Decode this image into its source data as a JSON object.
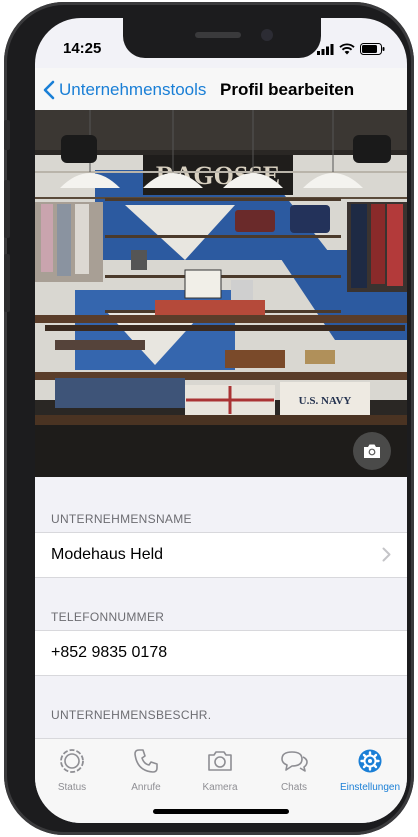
{
  "status_bar": {
    "time": "14:25"
  },
  "nav": {
    "back_label": "Unternehmenstools",
    "title": "Profil bearbeiten"
  },
  "hero": {
    "sign_text": "RAGOSSE",
    "crate_text": "U.S. NAVY",
    "camera_button_icon": "camera-icon"
  },
  "sections": [
    {
      "label": "UNTERNEHMENSNAME",
      "value": "Modehaus Held"
    },
    {
      "label": "TELEFONNUMMER",
      "value": "+852 9835 0178"
    },
    {
      "label": "UNTERNEHMENSBESCHR."
    }
  ],
  "tabs": [
    {
      "label": "Status",
      "icon": "status-icon"
    },
    {
      "label": "Anrufe",
      "icon": "phone-icon"
    },
    {
      "label": "Kamera",
      "icon": "camera-icon"
    },
    {
      "label": "Chats",
      "icon": "chat-bubbles-icon"
    },
    {
      "label": "Einstellungen",
      "icon": "gear-icon",
      "active": true
    }
  ],
  "colors": {
    "accent": "#1a7fd6",
    "inactive": "#8e8e93",
    "background": "#f2f2f7"
  }
}
